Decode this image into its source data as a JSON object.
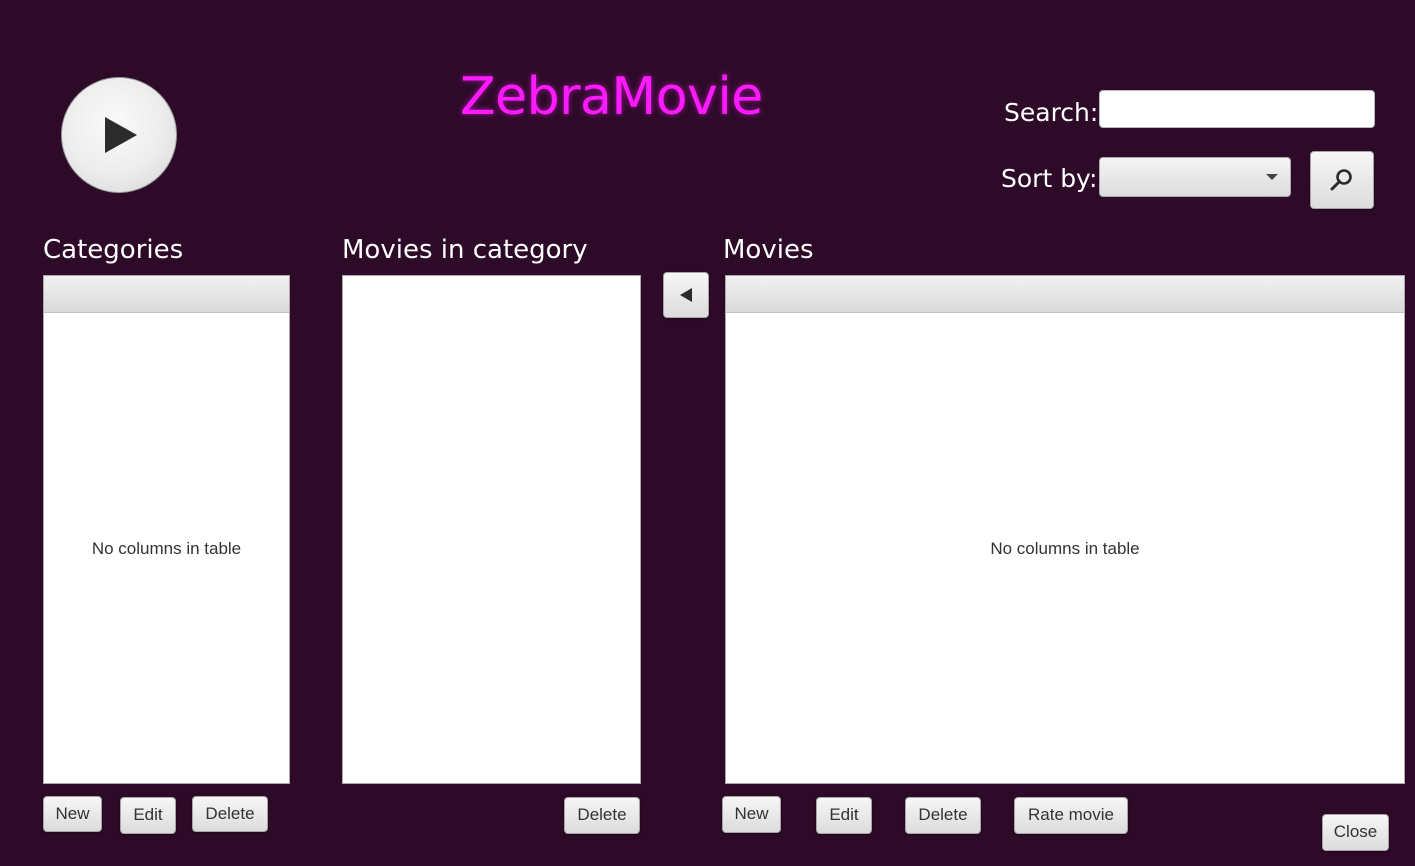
{
  "header": {
    "title": "ZebraMovie",
    "search_label": "Search:",
    "search_value": "",
    "sort_label": "Sort by:",
    "sort_value": ""
  },
  "icons": {
    "play": "play-icon",
    "search": "magnifier-icon",
    "move_left": "triangle-left-icon"
  },
  "colors": {
    "background": "#2e0a29",
    "title": "#ff1aff"
  },
  "categories": {
    "heading": "Categories",
    "placeholder": "No columns in table",
    "buttons": {
      "new": "New",
      "edit": "Edit",
      "delete": "Delete"
    }
  },
  "movies_in_category": {
    "heading": "Movies in category",
    "buttons": {
      "delete": "Delete"
    }
  },
  "movies": {
    "heading": "Movies",
    "placeholder": "No columns in table",
    "buttons": {
      "new": "New",
      "edit": "Edit",
      "delete": "Delete",
      "rate": "Rate movie"
    }
  },
  "footer": {
    "close": "Close"
  }
}
